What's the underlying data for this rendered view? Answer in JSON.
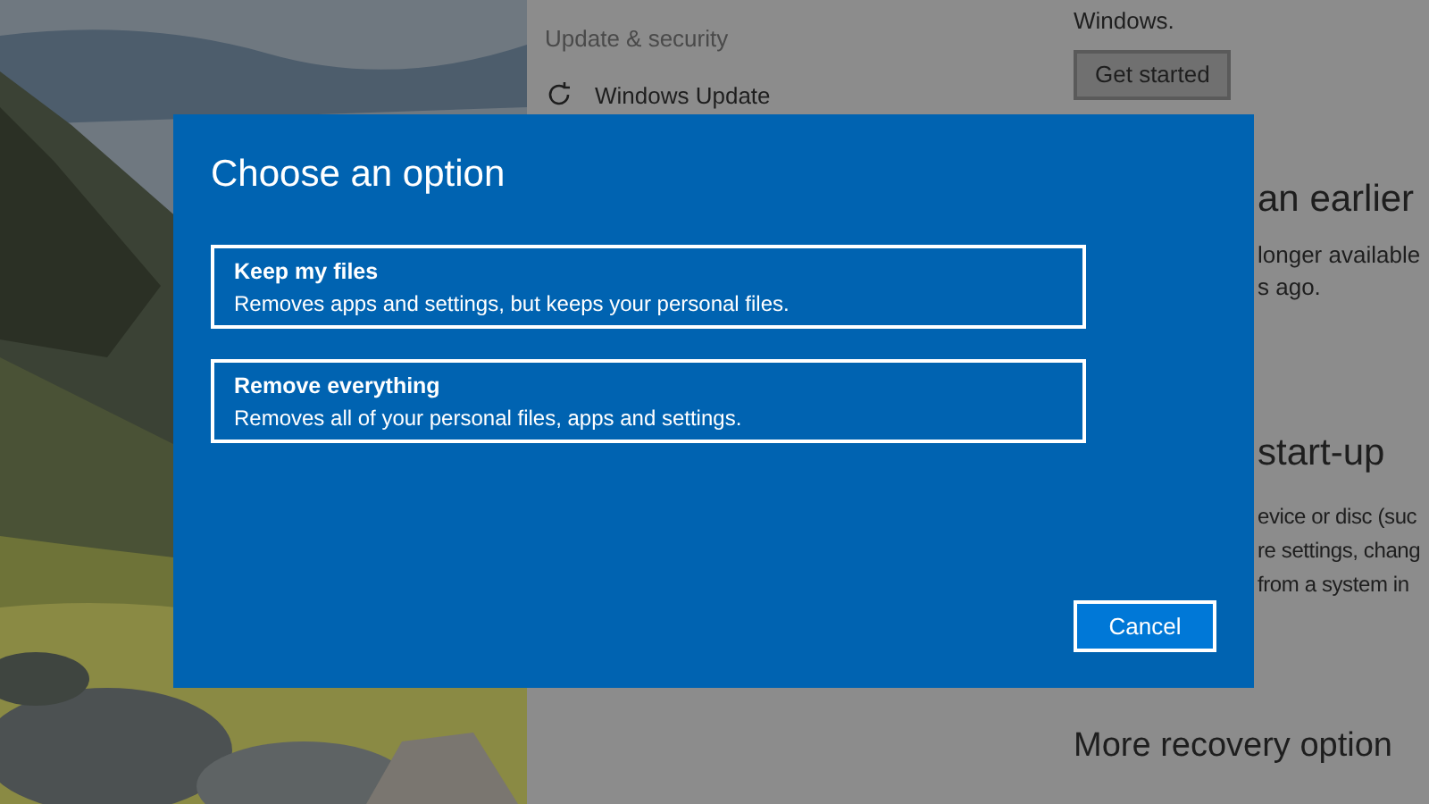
{
  "settings": {
    "section_title": "Update & security",
    "nav_items": [
      {
        "label": "Windows Update"
      }
    ],
    "intro_text": "Windows.",
    "get_started_button": "Get started",
    "earlier_heading": "an earlier",
    "earlier_lines": [
      "longer available",
      "s ago."
    ],
    "startup_heading": "start-up",
    "startup_lines": [
      "evice or disc (suc",
      "re settings, chang",
      "from a system in"
    ],
    "more_heading": "More recovery option"
  },
  "dialog": {
    "title": "Choose an option",
    "options": [
      {
        "title": "Keep my files",
        "description": "Removes apps and settings, but keeps your personal files."
      },
      {
        "title": "Remove everything",
        "description": "Removes all of your personal files, apps and settings."
      }
    ],
    "cancel_button": "Cancel"
  }
}
